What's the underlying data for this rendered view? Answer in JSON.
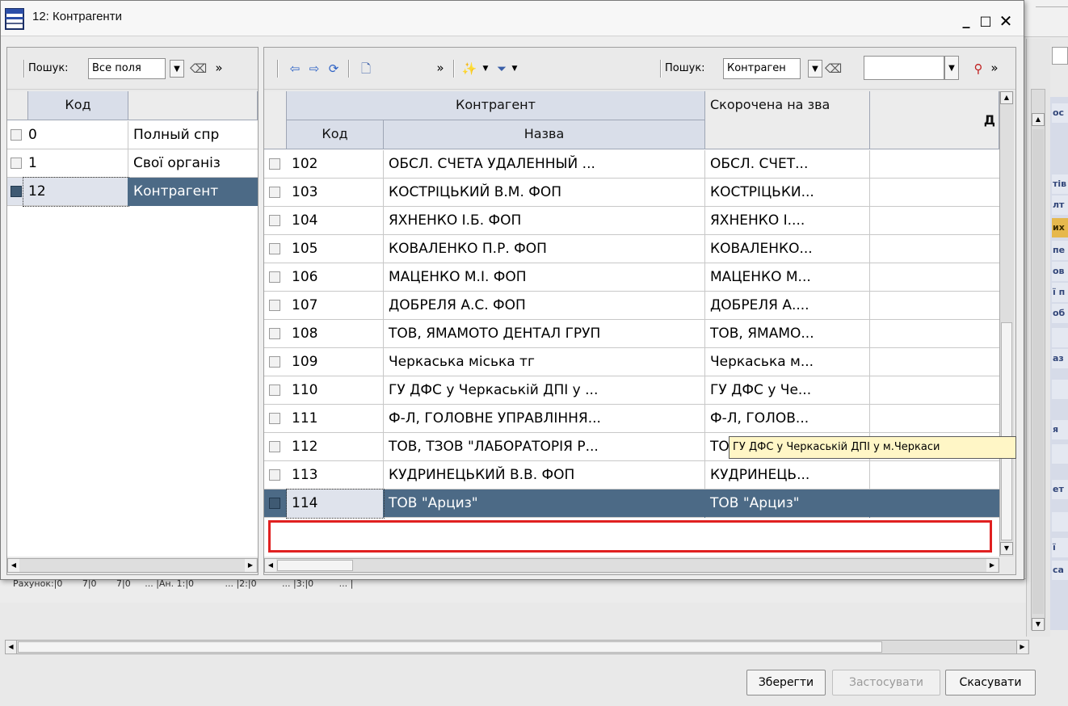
{
  "dialog": {
    "title": "12: Контрагенти",
    "controls": {
      "minimize": "_",
      "maximize": "□",
      "close": "✕"
    }
  },
  "left_panel": {
    "search_label": "Пошук:",
    "search_value": "Все поля",
    "more": "»",
    "columns": {
      "code": "Код",
      "name": ""
    },
    "rows": [
      {
        "code": "0",
        "name": "Полный спр",
        "selected": false
      },
      {
        "code": "1",
        "name": "Свої організ",
        "selected": false
      },
      {
        "code": "12",
        "name": "Контрагент",
        "selected": true
      }
    ]
  },
  "right_panel": {
    "more": "»",
    "search_label": "Пошук:",
    "search_value": "Контраген",
    "search_text": "",
    "header_group": "Контрагент",
    "columns": {
      "code": "Код",
      "name": "Назва",
      "short": "Скорочена на зва",
      "extra": "Д"
    },
    "rows": [
      {
        "code": "102",
        "name": "ОБСЛ. СЧЕТА  УДАЛЕННЫЙ ...",
        "short": "ОБСЛ. СЧЕТ..."
      },
      {
        "code": "103",
        "name": "КОСТРІЦЬКИЙ В.М. ФОП",
        "short": "КОСТРІЦЬКИ..."
      },
      {
        "code": "104",
        "name": "ЯХНЕНКО І.Б. ФОП",
        "short": "ЯХНЕНКО І...."
      },
      {
        "code": "105",
        "name": "КОВАЛЕНКО П.Р. ФОП",
        "short": "КОВАЛЕНКО..."
      },
      {
        "code": "106",
        "name": "МАЦЕНКО М.І. ФОП",
        "short": "МАЦЕНКО М..."
      },
      {
        "code": "107",
        "name": "ДОБРЕЛЯ А.С. ФОП",
        "short": "ДОБРЕЛЯ А...."
      },
      {
        "code": "108",
        "name": "ТОВ, ЯМАМОТО ДЕНТАЛ ГРУП",
        "short": "ТОВ, ЯМАМО..."
      },
      {
        "code": "109",
        "name": "Черкаська міська тг",
        "short": "Черкаська м..."
      },
      {
        "code": "110",
        "name": "ГУ ДФС у Черкаській ДПІ у ...",
        "short": "ГУ ДФС у Че..."
      },
      {
        "code": "111",
        "name": "Ф-Л, ГОЛОВНЕ УПРАВЛІННЯ...",
        "short": "Ф-Л, ГОЛОВ..."
      },
      {
        "code": "112",
        "name": "ТОВ, ТЗОВ \"ЛАБОРАТОРІЯ Р...",
        "short": "ТОВ, ТЗОВ \"..."
      },
      {
        "code": "113",
        "name": "КУДРИНЕЦЬКИЙ В.В. ФОП",
        "short": "КУДРИНЕЦЬ..."
      },
      {
        "code": "114",
        "name": "ТОВ \"Арциз\"",
        "short": "ТОВ \"Арциз\"",
        "selected": true
      }
    ],
    "tooltip": "ГУ ДФС у Черкаській ДПІ у м.Черкаси"
  },
  "background": {
    "close": "✕",
    "under_text": "Рахунок:|0       7|0       7|0     ... |Ан. 1:|0           ... |2:|0         ... |3:|0         ... |",
    "side_tabs": [
      "ос",
      "тів",
      "лт",
      "их",
      "пе",
      "ов",
      "ї п",
      "об",
      "",
      "аз",
      "",
      "я",
      "",
      "ет",
      "",
      "ї",
      "са"
    ],
    "buttons": {
      "save": "Зберегти",
      "apply": "Застосувати",
      "cancel": "Скасувати"
    }
  },
  "colors": {
    "selection": "#4c6a86",
    "header": "#d9dee9",
    "highlight": "#e02020",
    "tooltip": "#fff6c6"
  }
}
